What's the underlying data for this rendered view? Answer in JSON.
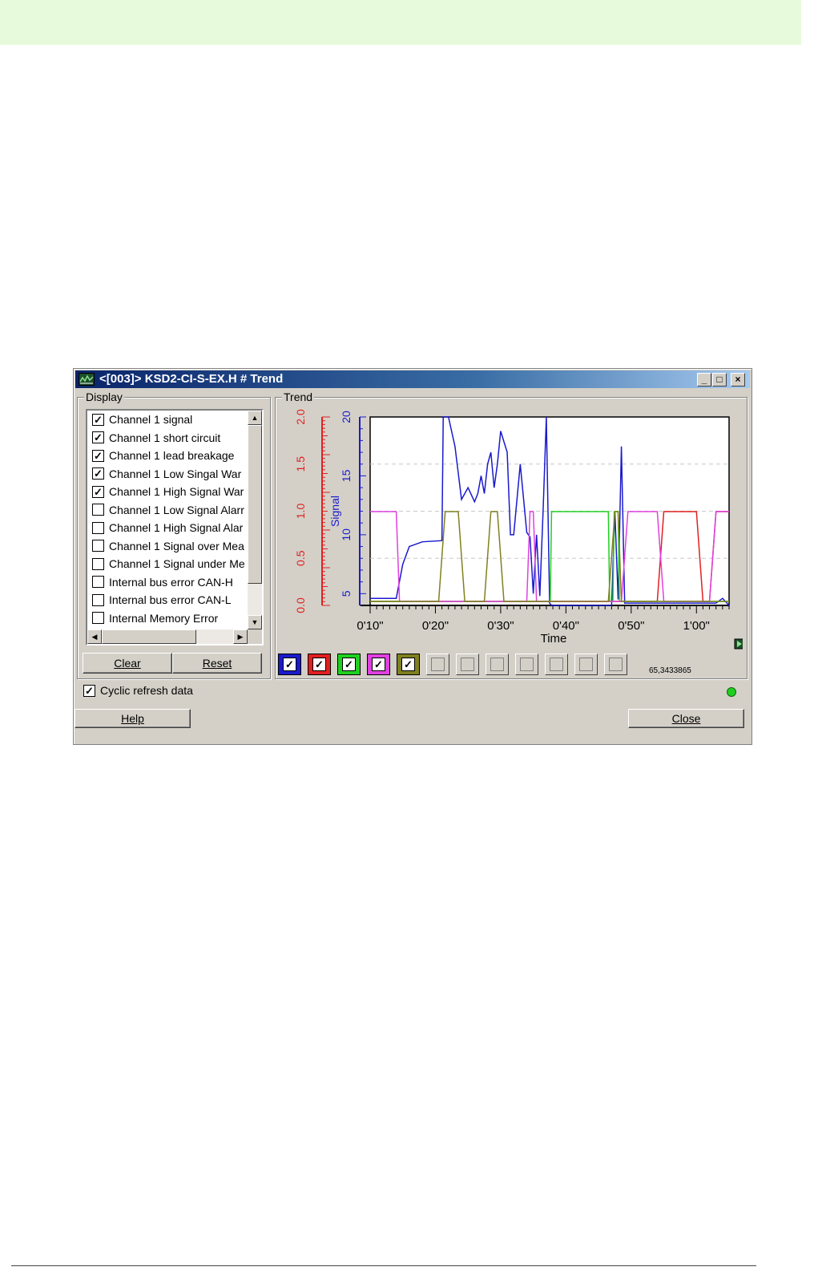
{
  "window": {
    "title": "<[003]> KSD2-CI-S-EX.H # Trend",
    "minimize": "_",
    "maximize": "□",
    "close": "×"
  },
  "display": {
    "group_label": "Display",
    "items": [
      {
        "label": "Channel 1 signal",
        "checked": true
      },
      {
        "label": "Channel 1 short circuit",
        "checked": true
      },
      {
        "label": "Channel 1 lead breakage",
        "checked": true
      },
      {
        "label": "Channel 1 Low Singal War",
        "checked": true
      },
      {
        "label": "Channel 1 High Signal War",
        "checked": true
      },
      {
        "label": "Channel 1 Low Signal Alarr",
        "checked": false
      },
      {
        "label": "Channel 1 High Signal Alar",
        "checked": false
      },
      {
        "label": "Channel 1 Signal over Mea",
        "checked": false
      },
      {
        "label": "Channel 1 Signal under Me",
        "checked": false
      },
      {
        "label": "Internal bus error CAN-H",
        "checked": false
      },
      {
        "label": "Internal bus error CAN-L",
        "checked": false
      },
      {
        "label": "Internal Memory Error",
        "checked": false
      }
    ],
    "clear_label": "Clear",
    "reset_label": "Reset"
  },
  "trend": {
    "group_label": "Trend",
    "readout": "65,3433865",
    "swatches": [
      {
        "color": "#1a1acc",
        "checked": true
      },
      {
        "color": "#e02020",
        "checked": true
      },
      {
        "color": "#20d020",
        "checked": true
      },
      {
        "color": "#e040e0",
        "checked": true
      },
      {
        "color": "#808020",
        "checked": true
      },
      {
        "color": null,
        "checked": false
      },
      {
        "color": null,
        "checked": false
      },
      {
        "color": null,
        "checked": false
      },
      {
        "color": null,
        "checked": false
      },
      {
        "color": null,
        "checked": false
      },
      {
        "color": null,
        "checked": false
      },
      {
        "color": null,
        "checked": false
      }
    ]
  },
  "footer": {
    "cyclic_label": "Cyclic refresh data",
    "cyclic_checked": true,
    "help_label": "Help",
    "close_label": "Close"
  },
  "colors": {
    "signal": "#1a1acc",
    "short_circuit": "#e02020",
    "lead_breakage": "#20d020",
    "low_warn": "#e040e0",
    "high_warn": "#808020",
    "status_led": "#20d020"
  },
  "chart_data": {
    "type": "line",
    "xlabel": "Time",
    "x_ticks": [
      "0'10\"",
      "0'20\"",
      "0'30\"",
      "0'40\"",
      "0'50\"",
      "1'00\""
    ],
    "xlim": [
      10,
      65
    ],
    "grid": true,
    "left_axis": {
      "ticks": [
        "0.0",
        "0.5",
        "1.0",
        "1.5",
        "2.0"
      ],
      "ylim": [
        0,
        2
      ],
      "color": "#e02020"
    },
    "right_axis": {
      "ylabel": "Signal",
      "ticks": [
        "5",
        "10",
        "15",
        "20"
      ],
      "ylim": [
        4,
        20
      ],
      "color": "#1a1acc"
    },
    "series": [
      {
        "key": "signal",
        "axis": "signal",
        "color": "#1a1acc",
        "x": [
          10,
          14,
          15,
          16,
          18,
          21,
          21.2,
          22,
          23,
          24,
          25,
          26,
          26.5,
          27,
          27.5,
          28,
          28.5,
          29,
          29.5,
          30,
          31,
          31.5,
          32,
          33,
          34,
          34.5,
          35,
          35.5,
          36,
          36.5,
          37,
          37.5,
          37.8,
          38,
          47,
          47.5,
          48,
          48.5,
          49,
          63,
          64,
          65
        ],
        "y": [
          4.6,
          4.6,
          7.5,
          9,
          9.4,
          9.5,
          20,
          20,
          17.5,
          13,
          14,
          12.8,
          13.5,
          15,
          13.5,
          16,
          17,
          14,
          16,
          18.8,
          17,
          10,
          10,
          16,
          10.2,
          9.8,
          5,
          10,
          4.8,
          12,
          20,
          4.2,
          4,
          4,
          4,
          12,
          4.5,
          17.5,
          4.2,
          4.2,
          4.6,
          4
        ]
      },
      {
        "key": "short_circuit",
        "axis": "state",
        "color": "#e02020",
        "x": [
          10,
          53,
          54,
          55,
          56,
          57,
          60,
          61,
          62,
          63,
          64,
          65
        ],
        "y": [
          0,
          0,
          0,
          1,
          1,
          1,
          1,
          0,
          0,
          1,
          1,
          1
        ]
      },
      {
        "key": "lead_breakage",
        "axis": "state",
        "color": "#20d020",
        "x": [
          10,
          37.6,
          37.8,
          46.5,
          46.7,
          47.2,
          47.4,
          48,
          48.2,
          65
        ],
        "y": [
          0,
          0,
          1,
          1,
          0,
          0,
          1,
          1,
          0,
          0
        ]
      },
      {
        "key": "low_warn",
        "axis": "state",
        "color": "#e040e0",
        "x": [
          10,
          14,
          14.5,
          34,
          34.5,
          35,
          35.5,
          48.5,
          49.5,
          54,
          55,
          56,
          57,
          61,
          62,
          63,
          64,
          65
        ],
        "y": [
          1,
          1,
          0,
          0,
          1,
          1,
          0,
          0,
          1,
          1,
          0,
          0,
          0,
          0,
          0,
          1,
          1,
          1
        ]
      },
      {
        "key": "high_warn",
        "axis": "state",
        "color": "#808020",
        "x": [
          10,
          20.5,
          21.5,
          23.5,
          24.5,
          27.5,
          28.5,
          29.5,
          30.5,
          46.5,
          47.5,
          48,
          48.5,
          65
        ],
        "y": [
          0,
          0,
          1,
          1,
          0,
          0,
          1,
          1,
          0,
          0,
          1,
          1,
          0,
          0
        ]
      }
    ]
  }
}
